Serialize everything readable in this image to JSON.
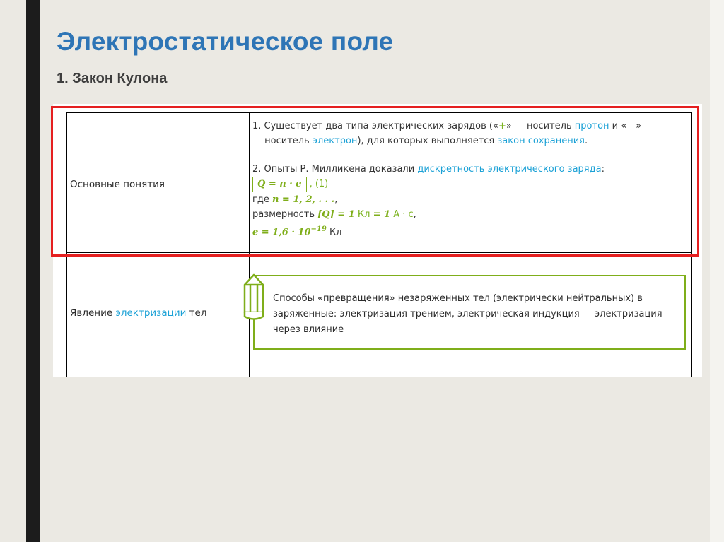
{
  "slide": {
    "title": "Электростатическое поле",
    "subtitle": "1. Закон Кулона"
  },
  "table": {
    "rows": [
      {
        "label": "Основные понятия",
        "item1": {
          "num": "1.",
          "text_a": " Существует два типа электрических зарядов («",
          "plus": "+",
          "text_b": "» — носитель ",
          "link_proton": "протон",
          "text_c": " и «",
          "minus": "—",
          "text_d": "»",
          "text_e": "— носитель ",
          "link_electron": "электрон",
          "text_f": "), для которых выполняется ",
          "link_conservation": "закон сохранения",
          "text_g": "."
        },
        "item2": {
          "num": "2.",
          "text_a": " Опыты Р. Милликена доказали ",
          "link_discrete": "дискретность электрического заряда",
          "text_b": ":",
          "formula": "Q = n · e",
          "eq_ref": ", (1)",
          "where_label": "где ",
          "where_formula": "n = 1, 2, . . .",
          "where_end": ",",
          "dim_label": "размерность ",
          "dim_formula_a": "[Q] = 1",
          "dim_unit_a": " Кл ",
          "dim_formula_b": "= 1",
          "dim_unit_b": " А · с",
          "dim_end": ",",
          "e_formula": "e = 1,6 · 10",
          "e_exp": "−19",
          "e_unit": " Кл"
        }
      },
      {
        "label_a": "Явление ",
        "label_link": "электризации",
        "label_b": " тел",
        "note": "Способы «превращения» незаряженных тел (электрически нейтральных) в заряженные: электризация трением, электрическая индукция — электризация через влияние"
      }
    ]
  },
  "colors": {
    "title": "#2e75b6",
    "link": "#1ba1d6",
    "formula_green": "#7fae1a",
    "highlight_red": "#e51f20"
  },
  "icons": {
    "note_icon": "pencil-icon"
  }
}
